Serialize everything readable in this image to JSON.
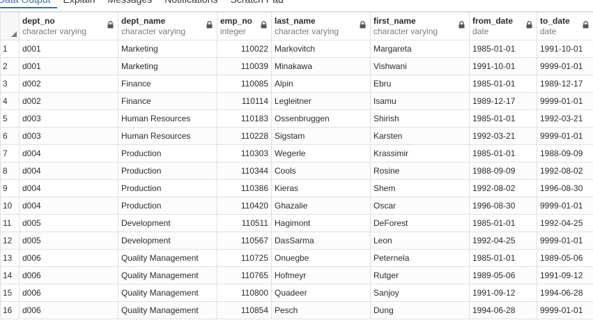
{
  "tabs": [
    "Data Output",
    "Explain",
    "Messages",
    "Notifications",
    "Scratch Pad"
  ],
  "columns": [
    {
      "name": "dept_no",
      "type": "character varying"
    },
    {
      "name": "dept_name",
      "type": "character varying"
    },
    {
      "name": "emp_no",
      "type": "integer"
    },
    {
      "name": "last_name",
      "type": "character varying"
    },
    {
      "name": "first_name",
      "type": "character varying"
    },
    {
      "name": "from_date",
      "type": "date"
    },
    {
      "name": "to_date",
      "type": "date"
    }
  ],
  "rows": [
    [
      "1",
      "d001",
      "Marketing",
      "110022",
      "Markovitch",
      "Margareta",
      "1985-01-01",
      "1991-10-01"
    ],
    [
      "2",
      "d001",
      "Marketing",
      "110039",
      "Minakawa",
      "Vishwani",
      "1991-10-01",
      "9999-01-01"
    ],
    [
      "3",
      "d002",
      "Finance",
      "110085",
      "Alpin",
      "Ebru",
      "1985-01-01",
      "1989-12-17"
    ],
    [
      "4",
      "d002",
      "Finance",
      "110114",
      "Legleitner",
      "Isamu",
      "1989-12-17",
      "9999-01-01"
    ],
    [
      "5",
      "d003",
      "Human Resources",
      "110183",
      "Ossenbruggen",
      "Shirish",
      "1985-01-01",
      "1992-03-21"
    ],
    [
      "6",
      "d003",
      "Human Resources",
      "110228",
      "Sigstam",
      "Karsten",
      "1992-03-21",
      "9999-01-01"
    ],
    [
      "7",
      "d004",
      "Production",
      "110303",
      "Wegerle",
      "Krassimir",
      "1985-01-01",
      "1988-09-09"
    ],
    [
      "8",
      "d004",
      "Production",
      "110344",
      "Cools",
      "Rosine",
      "1988-09-09",
      "1992-08-02"
    ],
    [
      "9",
      "d004",
      "Production",
      "110386",
      "Kieras",
      "Shem",
      "1992-08-02",
      "1996-08-30"
    ],
    [
      "10",
      "d004",
      "Production",
      "110420",
      "Ghazalie",
      "Oscar",
      "1996-08-30",
      "9999-01-01"
    ],
    [
      "11",
      "d005",
      "Development",
      "110511",
      "Hagimont",
      "DeForest",
      "1985-01-01",
      "1992-04-25"
    ],
    [
      "12",
      "d005",
      "Development",
      "110567",
      "DasSarma",
      "Leon",
      "1992-04-25",
      "9999-01-01"
    ],
    [
      "13",
      "d006",
      "Quality Management",
      "110725",
      "Onuegbe",
      "Peternela",
      "1985-01-01",
      "1989-05-06"
    ],
    [
      "14",
      "d006",
      "Quality Management",
      "110765",
      "Hofmeyr",
      "Rutger",
      "1989-05-06",
      "1991-09-12"
    ],
    [
      "15",
      "d006",
      "Quality Management",
      "110800",
      "Quadeer",
      "Sanjoy",
      "1991-09-12",
      "1994-06-28"
    ],
    [
      "16",
      "d006",
      "Quality Management",
      "110854",
      "Pesch",
      "Dung",
      "1994-06-28",
      "9999-01-01"
    ]
  ],
  "icons": {
    "column_lock": "lock-icon",
    "corner": "sort-triangle-icon"
  }
}
